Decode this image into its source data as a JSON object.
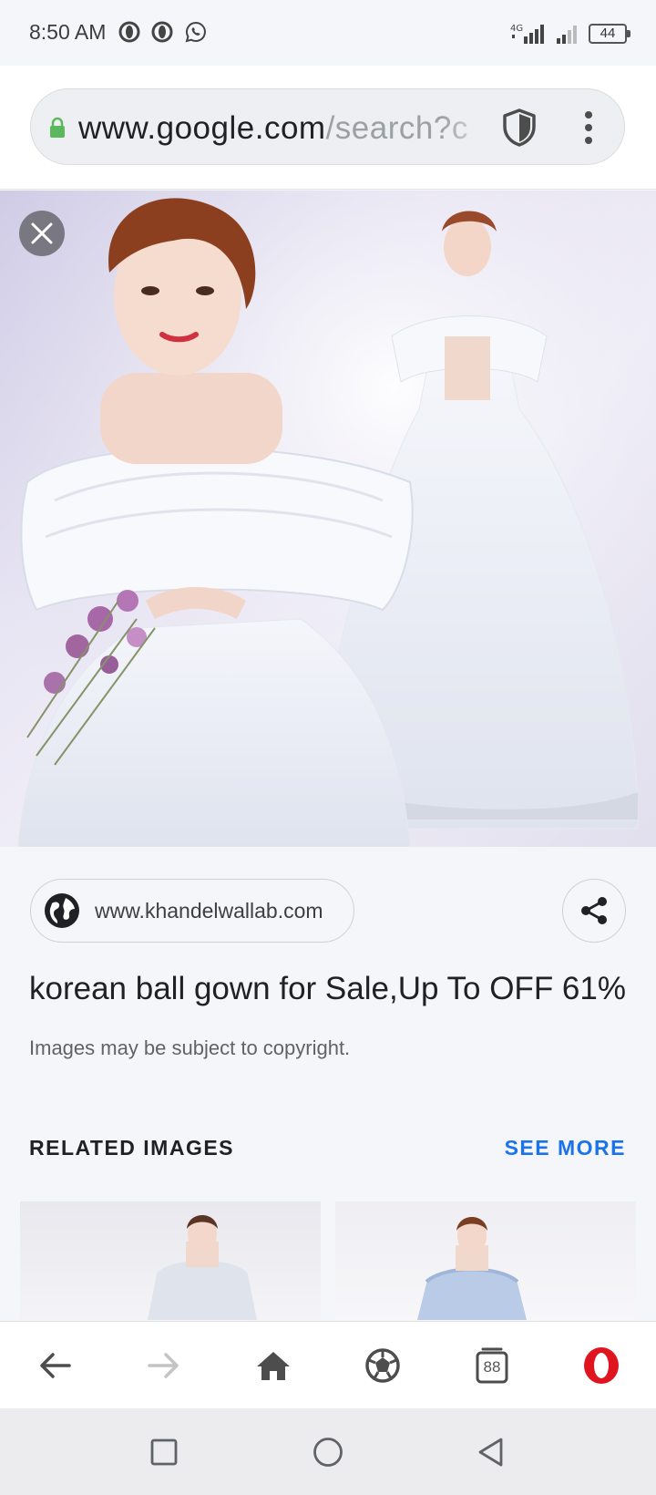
{
  "status_bar": {
    "time": "8:50 AM",
    "network_label": "4G",
    "battery_level": "44",
    "icons": [
      "opera-notification-icon",
      "opera-notification-icon",
      "whatsapp-icon",
      "signal-icon",
      "signal-icon",
      "battery-icon"
    ]
  },
  "url_bar": {
    "host": "www.google.com",
    "path": "/search?c",
    "secure": true
  },
  "image_viewer": {
    "source_site": "www.khandelwallab.com",
    "title": "korean ball gown for Sale,Up To OFF 61%",
    "copyright_note": "Images may be subject to copyright.",
    "related_heading": "RELATED IMAGES",
    "see_more_label": "SEE MORE"
  },
  "browser_bar": {
    "tabs_count": "88",
    "buttons": [
      "back-icon",
      "forward-icon",
      "home-icon",
      "speed-dial-icon",
      "tabs-icon",
      "opera-menu-icon"
    ]
  },
  "colors": {
    "accent_link": "#1a73e8",
    "lock_green": "#5cb85c",
    "opera_red": "#e0141e"
  }
}
